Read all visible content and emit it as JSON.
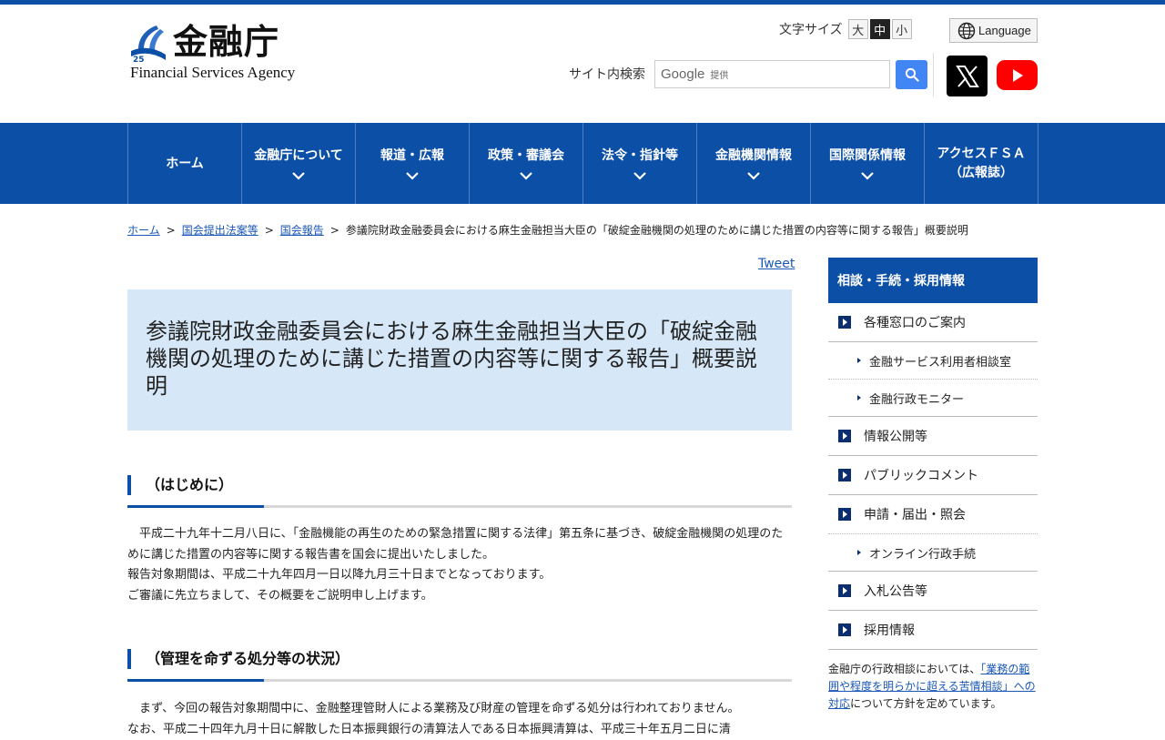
{
  "colors": {
    "brand_blue": "#0b4fa6",
    "title_bg": "#d6e8f8",
    "link": "#1a57b6"
  },
  "header": {
    "logo_title": "金融庁",
    "logo_sub": "Financial Services Agency",
    "logo_badge": "25",
    "font_size_label": "文字サイズ",
    "font_sizes": [
      "大",
      "中",
      "小"
    ],
    "font_size_selected": "中",
    "language_label": "Language",
    "search_label": "サイト内検索",
    "search_google": "Google",
    "search_teikyo": "提供",
    "icons": [
      "globe-icon",
      "search-icon",
      "x-icon",
      "youtube-icon"
    ]
  },
  "nav": {
    "items": [
      {
        "label": "ホーム"
      },
      {
        "label": "金融庁について"
      },
      {
        "label": "報道・広報"
      },
      {
        "label": "政策・審議会"
      },
      {
        "label": "法令・指針等"
      },
      {
        "label": "金融機関情報"
      },
      {
        "label": "国際関係情報"
      },
      {
        "label_line1": "アクセスＦＳＡ",
        "label_line2": "（広報誌）"
      }
    ]
  },
  "breadcrumb": {
    "items": [
      "ホーム",
      "国会提出法案等",
      "国会報告"
    ],
    "current": "参議院財政金融委員会における麻生金融担当大臣の「破綻金融機関の処理のために講じた措置の内容等に関する報告」概要説明",
    "separator": ">"
  },
  "main": {
    "tweet": "Tweet",
    "title": "参議院財政金融委員会における麻生金融担当大臣の「破綻金融機関の処理のために講じた措置の内容等に関する報告」概要説明",
    "section1": {
      "heading": "（はじめに）",
      "lines": [
        "平成二十九年十二月八日に、「金融機能の再生のための緊急措置に関する法律」第五条に基づき、破綻金融機関の処理のために講じた措置の内容等に関する報告書を国会に提出いたしました。",
        "報告対象期間は、平成二十九年四月一日以降九月三十日までとなっております。",
        "ご審議に先立ちまして、その概要をご説明申し上げます。"
      ]
    },
    "section2": {
      "heading": "（管理を命ずる処分等の状況）",
      "lines": [
        "まず、今回の報告対象期間中に、金融整理管財人による業務及び財産の管理を命ずる処分は行われておりません。",
        "なお、平成二十四年九月十日に解散した日本振興銀行の清算法人である日本振興清算は、平成三十年五月二日に清"
      ]
    }
  },
  "sidebar": {
    "heading": "相談・手続・採用情報",
    "items": [
      {
        "label": "各種窓口のご案内",
        "type": "main"
      },
      {
        "label": "金融サービス利用者相談室",
        "type": "sub"
      },
      {
        "label": "金融行政モニター",
        "type": "sub"
      },
      {
        "label": "情報公開等",
        "type": "main"
      },
      {
        "label": "パブリックコメント",
        "type": "main"
      },
      {
        "label": "申請・届出・照会",
        "type": "main"
      },
      {
        "label": "オンライン行政手続",
        "type": "sub"
      },
      {
        "label": "入札公告等",
        "type": "main"
      },
      {
        "label": "採用情報",
        "type": "main"
      }
    ],
    "note_pre": "金融庁の行政相談においては、",
    "note_link": "「業務の範囲や程度を明らかに超える苦情相談」への対応",
    "note_post": "について方針を定めています。"
  }
}
